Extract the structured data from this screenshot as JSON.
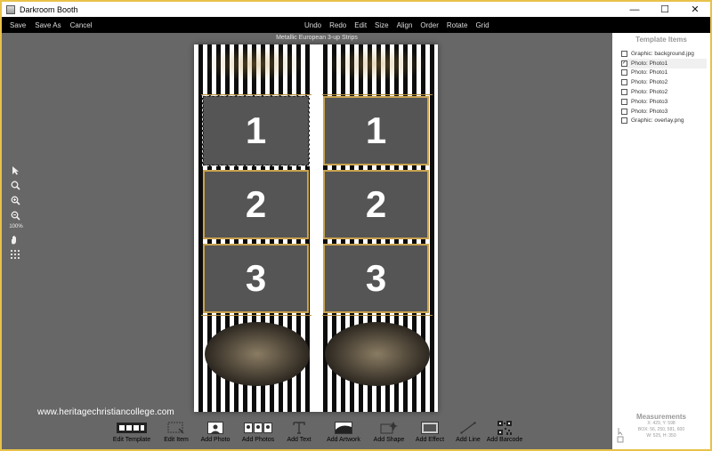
{
  "window": {
    "title": "Darkroom Booth",
    "minimize_glyph": "—",
    "maximize_glyph": "☐",
    "close_glyph": "✕"
  },
  "menu": {
    "left": [
      "Save",
      "Save As",
      "Cancel"
    ],
    "right": [
      "Undo",
      "Redo",
      "Edit",
      "Size",
      "Align",
      "Order",
      "Rotate",
      "Grid"
    ]
  },
  "canvas": {
    "title": "Metallic European 3-up Strips"
  },
  "toolbox": {
    "zoom_level": "100%",
    "icons": [
      "pointer-icon",
      "zoom-icon",
      "zoom-in-icon",
      "zoom-out-icon",
      "pan-hand-icon",
      "grid-icon"
    ]
  },
  "photos": {
    "left": [
      "1",
      "2",
      "3"
    ],
    "right": [
      "1",
      "2",
      "3"
    ]
  },
  "watermark": "www.heritagechristiancollege.com",
  "template_items": {
    "title": "Template Items",
    "items": [
      {
        "label": "Graphic: background.jpg",
        "checked": false
      },
      {
        "label": "Photo: Photo1",
        "checked": true
      },
      {
        "label": "Photo: Photo1",
        "checked": false
      },
      {
        "label": "Photo: Photo2",
        "checked": false
      },
      {
        "label": "Photo: Photo2",
        "checked": false
      },
      {
        "label": "Photo: Photo3",
        "checked": false
      },
      {
        "label": "Photo: Photo3",
        "checked": false
      },
      {
        "label": "Graphic: overlay.png",
        "checked": false
      }
    ]
  },
  "measurements": {
    "title": "Measurements",
    "xy": "X: 429, Y: 598",
    "box": "BOX: 56, 250, 581, 600",
    "wh": "W: 525, H: 350"
  },
  "bottom_tools": [
    {
      "label": "Edit Template",
      "icon": "film-strip-icon"
    },
    {
      "label": "Edit Item",
      "icon": "edit-item-icon"
    },
    {
      "label": "Add Photo",
      "icon": "photo-icon"
    },
    {
      "label": "Add Photos",
      "icon": "photos-icon"
    },
    {
      "label": "Add Text",
      "icon": "text-icon"
    },
    {
      "label": "Add Artwork",
      "icon": "artwork-icon"
    },
    {
      "label": "Add Shape",
      "icon": "shape-icon"
    },
    {
      "label": "Add Effect",
      "icon": "effect-icon"
    },
    {
      "label": "Add Line",
      "icon": "line-icon"
    },
    {
      "label": "Add Barcode",
      "icon": "barcode-icon"
    }
  ]
}
